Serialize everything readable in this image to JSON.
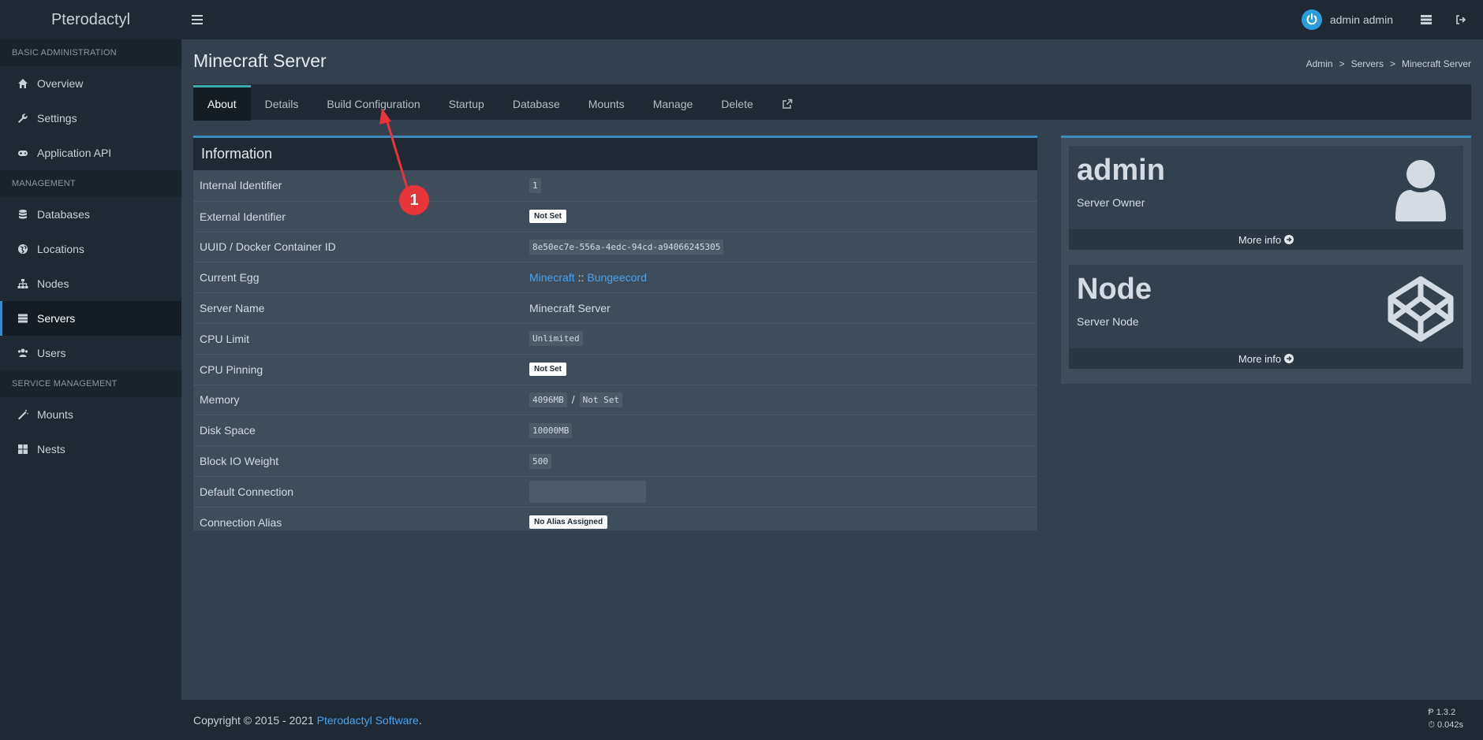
{
  "brand": "Pterodactyl",
  "user": {
    "name": "admin admin"
  },
  "sidebar": {
    "sections": [
      {
        "header": "BASIC ADMINISTRATION",
        "items": [
          {
            "label": "Overview",
            "icon": "home-icon"
          },
          {
            "label": "Settings",
            "icon": "wrench-icon"
          },
          {
            "label": "Application API",
            "icon": "gamepad-icon"
          }
        ]
      },
      {
        "header": "MANAGEMENT",
        "items": [
          {
            "label": "Databases",
            "icon": "database-icon"
          },
          {
            "label": "Locations",
            "icon": "globe-icon"
          },
          {
            "label": "Nodes",
            "icon": "sitemap-icon"
          },
          {
            "label": "Servers",
            "icon": "server-icon",
            "active": true
          },
          {
            "label": "Users",
            "icon": "users-icon"
          }
        ]
      },
      {
        "header": "SERVICE MANAGEMENT",
        "items": [
          {
            "label": "Mounts",
            "icon": "magic-icon"
          },
          {
            "label": "Nests",
            "icon": "th-large-icon"
          }
        ]
      }
    ]
  },
  "page": {
    "title": "Minecraft Server"
  },
  "breadcrumb": {
    "items": [
      "Admin",
      "Servers",
      "Minecraft Server"
    ],
    "sep": ">"
  },
  "tabs": [
    "About",
    "Details",
    "Build Configuration",
    "Startup",
    "Database",
    "Mounts",
    "Manage",
    "Delete"
  ],
  "info": {
    "title": "Information",
    "rows": [
      {
        "label": "Internal Identifier",
        "code": "1"
      },
      {
        "label": "External Identifier",
        "badge": "Not Set"
      },
      {
        "label": "UUID / Docker Container ID",
        "code": "8e50ec7e-556a-4edc-94cd-a94066245305"
      },
      {
        "label": "Current Egg",
        "egg_a": "Minecraft",
        "egg_sep": "::",
        "egg_b": "Bungeecord"
      },
      {
        "label": "Server Name",
        "text": "Minecraft Server"
      },
      {
        "label": "CPU Limit",
        "code": "Unlimited"
      },
      {
        "label": "CPU Pinning",
        "badge": "Not Set"
      },
      {
        "label": "Memory",
        "code": "4096MB",
        "sep": "/",
        "code2": "Not Set"
      },
      {
        "label": "Disk Space",
        "code": "10000MB"
      },
      {
        "label": "Block IO Weight",
        "code": "500"
      },
      {
        "label": "Default Connection"
      },
      {
        "label": "Connection Alias",
        "badge": "No Alias Assigned"
      }
    ]
  },
  "owner_box": {
    "title": "admin",
    "subtitle": "Server Owner",
    "more": "More info"
  },
  "node_box": {
    "title": "Node",
    "subtitle": "Server Node",
    "more": "More info"
  },
  "annotation": {
    "number": "1"
  },
  "footer": {
    "copyright": "Copyright © 2015 - 2021",
    "link": "Pterodactyl Software",
    "period": ".",
    "version": "1.3.2",
    "time": "0.042s"
  },
  "colors": {
    "accent": "#3c8dbc",
    "tab_active": "#38a8a8",
    "link": "#4ba3f0",
    "annotation": "#e8353a"
  }
}
